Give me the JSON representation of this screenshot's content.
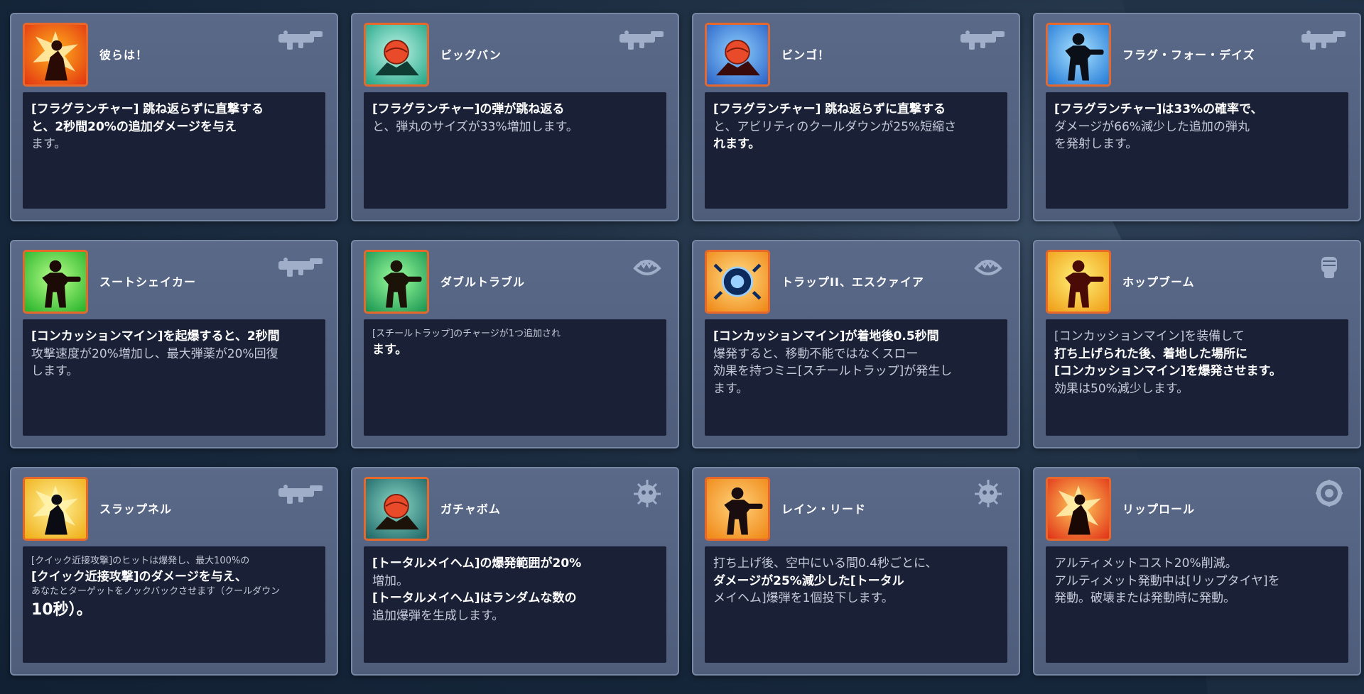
{
  "cards": [
    {
      "title": "彼らは！",
      "portrait": "red-fire-hero-icon",
      "type_icon": "frag-launcher-icon",
      "lines": [
        {
          "text": "[フラグランチャー] 跳ね返らずに直撃する",
          "style": "b"
        },
        {
          "text": "と、2秒間20%の追加ダメージを与え",
          "style": "b"
        },
        {
          "text": "ます。",
          "style": ""
        }
      ]
    },
    {
      "title": "ビッグバン",
      "portrait": "teal-ball-icon",
      "type_icon": "frag-launcher-icon",
      "lines": [
        {
          "text": "[フラグランチャー]の弾が跳ね返る",
          "style": "b"
        },
        {
          "text": "と、弾丸のサイズが33%増加します。",
          "style": ""
        }
      ]
    },
    {
      "title": "ビンゴ！",
      "portrait": "blue-ball-hero-icon",
      "type_icon": "frag-launcher-icon",
      "lines": [
        {
          "text": "[フラグランチャー] 跳ね返らずに直撃する",
          "style": "b"
        },
        {
          "text": "と、アビリティのクールダウンが25%短縮さ",
          "style": ""
        },
        {
          "text": "れます。",
          "style": "b"
        }
      ]
    },
    {
      "title": "フラグ・フォー・デイズ",
      "portrait": "blue-launcher-hero-icon",
      "type_icon": "frag-launcher-icon",
      "lines": [
        {
          "text": "[フラグランチャー]は33%の確率で、",
          "style": "b"
        },
        {
          "text": "ダメージが66%減少した追加の弾丸",
          "style": ""
        },
        {
          "text": "を発射します。",
          "style": ""
        }
      ]
    },
    {
      "title": "スートシェイカー",
      "portrait": "green-hero-up-icon",
      "type_icon": "frag-launcher-icon",
      "lines": [
        {
          "text": "[コンカッションマイン]を起爆すると、2秒間",
          "style": "b"
        },
        {
          "text": "攻撃速度が20%増加し、最大弾薬が20%回復",
          "style": ""
        },
        {
          "text": "します。",
          "style": ""
        }
      ]
    },
    {
      "title": "ダブルトラブル",
      "portrait": "green-double-trap-icon",
      "type_icon": "steel-trap-icon",
      "lines": [
        {
          "text": "[スチールトラップ]のチャージが1つ追加され",
          "style": "s"
        },
        {
          "text": "ます。",
          "style": "b"
        }
      ]
    },
    {
      "title": "トラップII、エスクァイア",
      "portrait": "blue-trap-icon",
      "type_icon": "steel-trap-icon",
      "lines": [
        {
          "text": "[コンカッションマイン]が着地後0.5秒間",
          "style": "b"
        },
        {
          "text": "爆発すると、移動不能ではなくスロー",
          "style": ""
        },
        {
          "text": "効果を持つミニ[スチールトラップ]が発生し",
          "style": ""
        },
        {
          "text": "ます。",
          "style": ""
        }
      ]
    },
    {
      "title": "ホップブーム",
      "portrait": "yellow-jump-hero-icon",
      "type_icon": "fist-icon",
      "lines": [
        {
          "text": "[コンカッションマイン]を装備して",
          "style": ""
        },
        {
          "text": "打ち上げられた後、着地した場所に",
          "style": "b"
        },
        {
          "text": "[コンカッションマイン]を爆発させます。",
          "style": "b"
        },
        {
          "text": "効果は50%減少します。",
          "style": ""
        }
      ]
    },
    {
      "title": "スラップネル",
      "portrait": "yellow-punch-hero-icon",
      "type_icon": "frag-launcher-icon",
      "lines": [
        {
          "text": "[クイック近接攻撃]のヒットは爆発し、最大100%の",
          "style": "s"
        },
        {
          "text": "[クイック近接攻撃]のダメージを与え、",
          "style": "b"
        },
        {
          "text": "あなたとターゲットをノックバックさせます（クールダウン",
          "style": "s"
        },
        {
          "text": "10秒）。",
          "style": "xl"
        }
      ]
    },
    {
      "title": "ガチャボム",
      "portrait": "teal-bomb-hero-icon",
      "type_icon": "total-mayhem-icon",
      "lines": [
        {
          "text": "[トータルメイヘム]の爆発範囲が20%",
          "style": "b"
        },
        {
          "text": "増加。",
          "style": ""
        },
        {
          "text": "[トータルメイヘム]はランダムな数の",
          "style": "b"
        },
        {
          "text": "追加爆弾を生成します。",
          "style": ""
        }
      ]
    },
    {
      "title": "レイン・リード",
      "portrait": "orange-rain-icon",
      "type_icon": "total-mayhem-icon",
      "lines": [
        {
          "text": "打ち上げ後、空中にいる間0.4秒ごとに、",
          "style": ""
        },
        {
          "text": "ダメージが25%減少した[トータル",
          "style": "b"
        },
        {
          "text": "メイヘム]爆弾を1個投下します。",
          "style": ""
        }
      ]
    },
    {
      "title": "リップロール",
      "portrait": "red-riptire-icon",
      "type_icon": "riptire-icon",
      "lines": [
        {
          "text": "アルティメットコスト20%削減。",
          "style": ""
        },
        {
          "text": "アルティメット発動中は[リップタイヤ]を",
          "style": ""
        },
        {
          "text": "発動。破壊または発動時に発動。",
          "style": ""
        }
      ]
    }
  ],
  "colors": {
    "card_border": "#7787a6",
    "portrait_border": "#e8672a",
    "desc_bg": "#1a2136"
  }
}
